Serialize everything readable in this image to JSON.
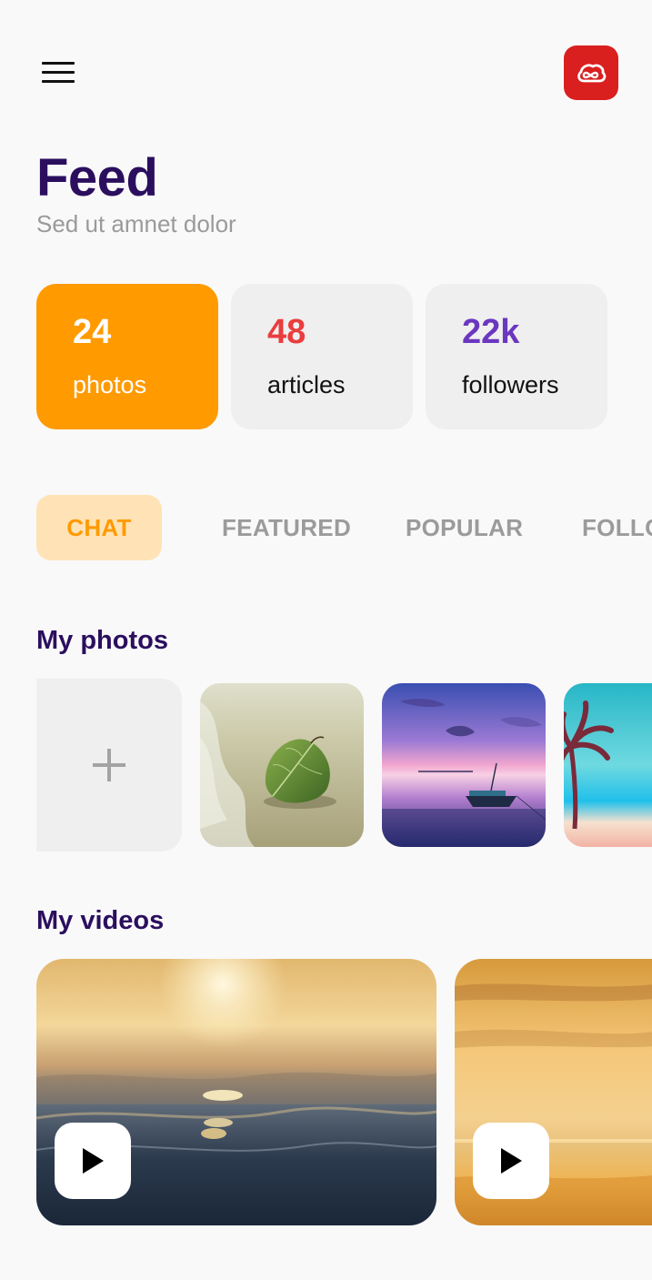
{
  "header": {
    "menu_icon": "hamburger-menu-icon",
    "app_icon": "creative-cloud-icon",
    "title": "Feed",
    "subtitle": "Sed ut amnet dolor"
  },
  "stats": [
    {
      "value": "24",
      "label": "photos",
      "color": "#ff9a00"
    },
    {
      "value": "48",
      "label": "articles",
      "color": "#ea3d3d"
    },
    {
      "value": "22k",
      "label": "followers",
      "color": "#6b37bf"
    }
  ],
  "tabs": [
    {
      "label": "CHAT",
      "active": true
    },
    {
      "label": "FEATURED",
      "active": false
    },
    {
      "label": "POPULAR",
      "active": false
    },
    {
      "label": "FOLLOWING",
      "active": false
    }
  ],
  "photos_section": {
    "title": "My photos",
    "add_icon": "plus-icon",
    "items": [
      "leaf-on-beach",
      "boat-at-sunset",
      "palm-tree-beach"
    ]
  },
  "videos_section": {
    "title": "My videos",
    "play_icon": "play-icon",
    "items": [
      "ocean-sunset-waves",
      "beach-sunset"
    ]
  },
  "colors": {
    "accent": "#ff9a00",
    "accent_light": "#ffe3b6",
    "title": "#2b0f5e",
    "brand_red": "#da1f1f"
  }
}
